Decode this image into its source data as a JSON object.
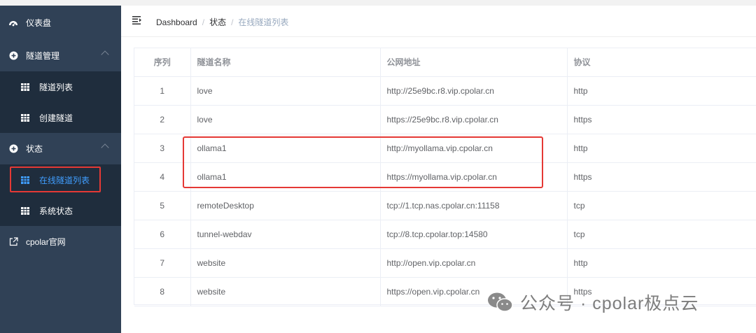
{
  "sidebar": {
    "items": [
      {
        "label": "仪表盘",
        "icon": "dashboard-icon"
      },
      {
        "label": "隧道管理",
        "icon": "plus-circle-icon"
      },
      {
        "label": "隧道列表",
        "icon": "table-icon"
      },
      {
        "label": "创建隧道",
        "icon": "table-icon"
      },
      {
        "label": "状态",
        "icon": "plus-circle-icon"
      },
      {
        "label": "在线隧道列表",
        "icon": "table-icon"
      },
      {
        "label": "系统状态",
        "icon": "table-icon"
      },
      {
        "label": "cpolar官网",
        "icon": "external-link-icon"
      }
    ]
  },
  "breadcrumb": {
    "home": "Dashboard",
    "section": "状态",
    "current": "在线隧道列表",
    "separator": "/"
  },
  "table": {
    "headers": [
      "序列",
      "隧道名称",
      "公网地址",
      "协议"
    ],
    "rows": [
      {
        "index": "1",
        "name": "love",
        "url": "http://25e9bc.r8.vip.cpolar.cn",
        "protocol": "http"
      },
      {
        "index": "2",
        "name": "love",
        "url": "https://25e9bc.r8.vip.cpolar.cn",
        "protocol": "https"
      },
      {
        "index": "3",
        "name": "ollama1",
        "url": "http://myollama.vip.cpolar.cn",
        "protocol": "http"
      },
      {
        "index": "4",
        "name": "ollama1",
        "url": "https://myollama.vip.cpolar.cn",
        "protocol": "https"
      },
      {
        "index": "5",
        "name": "remoteDesktop",
        "url": "tcp://1.tcp.nas.cpolar.cn:11158",
        "protocol": "tcp"
      },
      {
        "index": "6",
        "name": "tunnel-webdav",
        "url": "tcp://8.tcp.cpolar.top:14580",
        "protocol": "tcp"
      },
      {
        "index": "7",
        "name": "website",
        "url": "http://open.vip.cpolar.cn",
        "protocol": "http"
      },
      {
        "index": "8",
        "name": "website",
        "url": "https://open.vip.cpolar.cn",
        "protocol": "https"
      }
    ]
  },
  "watermark": {
    "text": "公众号 · cpolar极点云"
  },
  "colors": {
    "sidebar_bg": "#304156",
    "submenu_bg": "#1f2d3d",
    "active": "#409eff",
    "highlight": "#e53935"
  }
}
